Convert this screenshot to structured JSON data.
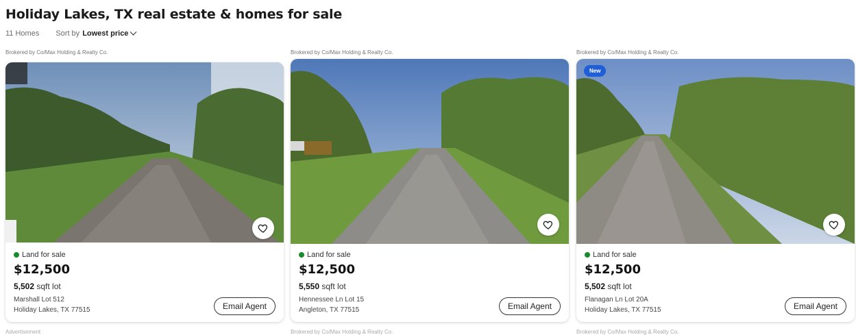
{
  "page": {
    "title": "Holiday Lakes, TX real estate & homes for sale",
    "count": "11 Homes",
    "sort_label": "Sort by",
    "sort_value": "Lowest price"
  },
  "cards": [
    {
      "brokered": "Brokered by Co/Max Holding & Realty Co.",
      "status": "Land for sale",
      "price": "$12,500",
      "lot_size": "5,502",
      "lot_unit": "sqft lot",
      "address_line1": "Marshall Lot 512",
      "address_line2": "Holiday Lakes, TX 77515",
      "badge": "",
      "action": "Email Agent"
    },
    {
      "brokered": "Brokered by Co/Max Holding & Realty Co.",
      "status": "Land for sale",
      "price": "$12,500",
      "lot_size": "5,550",
      "lot_unit": "sqft lot",
      "address_line1": "Hennessee Ln Lot 15",
      "address_line2": "Angleton, TX 77515",
      "badge": "",
      "action": "Email Agent"
    },
    {
      "brokered": "Brokered by Co/Max Holding & Realty Co.",
      "status": "Land for sale",
      "price": "$12,500",
      "lot_size": "5,502",
      "lot_unit": "sqft lot",
      "address_line1": "Flanagan Ln Lot 20A",
      "address_line2": "Holiday Lakes, TX 77515",
      "badge": "New",
      "action": "Email Agent"
    }
  ],
  "bottom": [
    "Advertisement",
    "Brokered by Co/Max Holding & Realty Co.",
    "Brokered by Co/Max Holding & Realty Co."
  ],
  "colors": {
    "status_dot": "#1a8a2e",
    "badge": "#1f5ed6"
  },
  "icons": {
    "favorite": "heart-outline-icon",
    "sort": "chevron-down-icon"
  }
}
